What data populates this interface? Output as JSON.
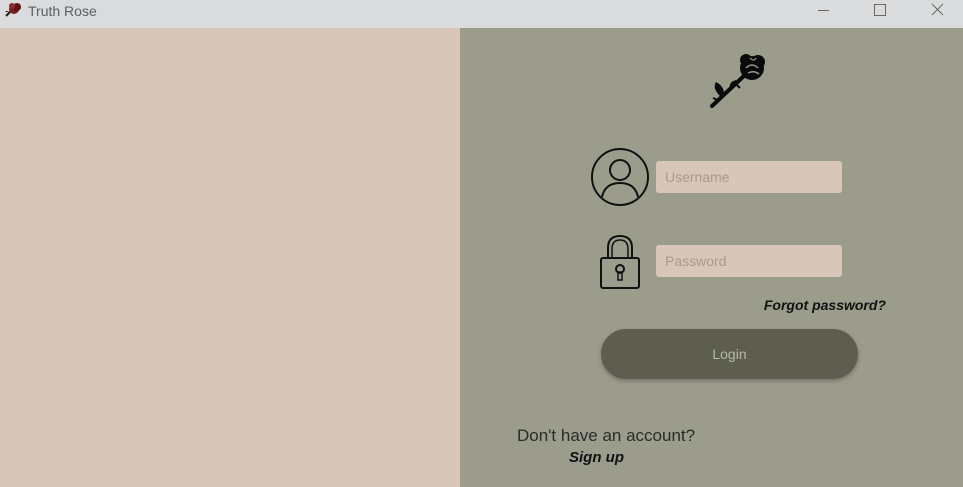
{
  "window": {
    "title": "Truth Rose",
    "icons": {
      "app": "rose-icon",
      "minimize": "minimize-icon",
      "maximize": "maximize-icon",
      "close": "close-icon"
    }
  },
  "login": {
    "logo_icon": "rose-logo-icon",
    "username_icon": "user-avatar-icon",
    "password_icon": "padlock-icon",
    "username_placeholder": "Username",
    "username_value": "",
    "password_placeholder": "Password",
    "password_value": "",
    "forgot_label": "Forgot password?",
    "login_label": "Login",
    "no_account_text": "Don't have an account?",
    "signup_label": "Sign up"
  },
  "colors": {
    "left_panel": "#d8c7b8",
    "right_panel": "#9c9c8d",
    "input_bg": "#d8c7b8",
    "login_button": "#5d5e50",
    "titlebar": "#d9dbdc"
  }
}
